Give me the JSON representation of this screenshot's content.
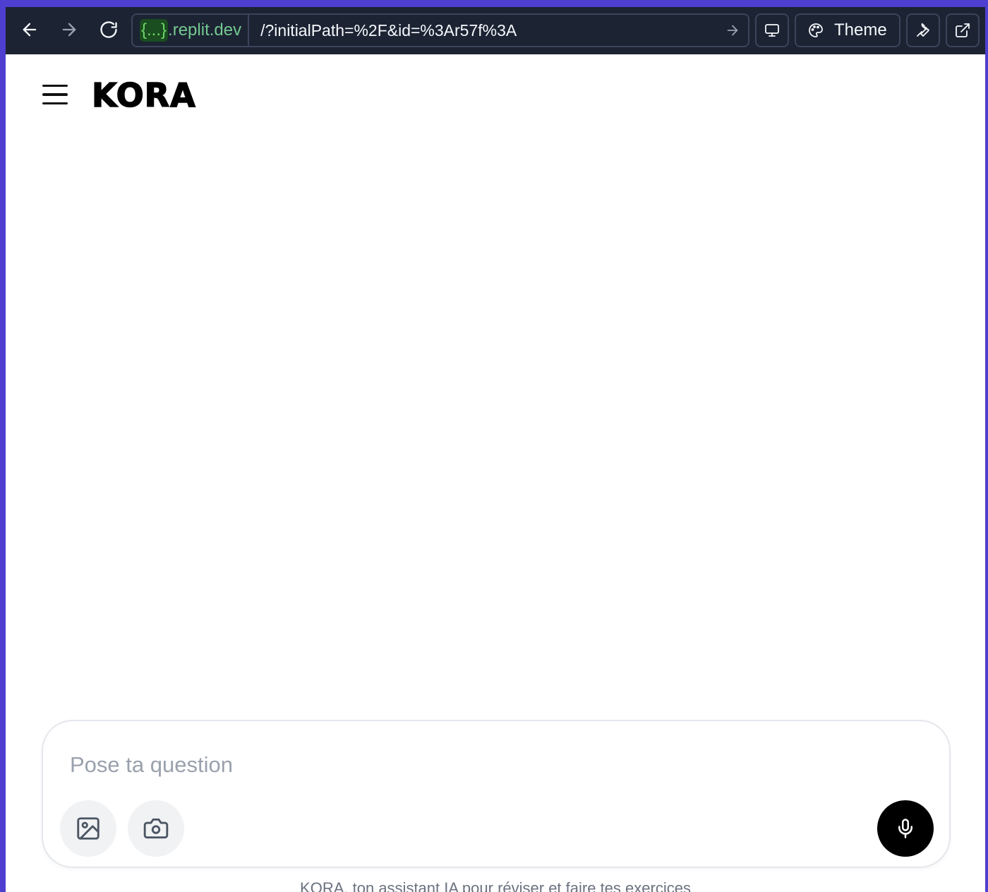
{
  "browser": {
    "domain_prefix": "{...}",
    "domain_suffix": ".replit.dev",
    "url_path": "/?initialPath=%2F&id=%3Ar57f%3A",
    "theme_label": "Theme"
  },
  "app": {
    "logo": "KORA",
    "composer": {
      "placeholder": "Pose ta question"
    },
    "footer_caption": "KORA, ton assistant IA pour réviser et faire tes exercices"
  },
  "colors": {
    "outer_accent": "#4f3fd1",
    "browser_bar": "#1c2333",
    "domain_green": "#73c991",
    "mic_button": "#000000"
  },
  "icons": {
    "back": "arrow-left-icon",
    "forward": "arrow-right-icon",
    "reload": "reload-icon",
    "go": "arrow-right-icon",
    "devices": "monitor-icon",
    "theme": "palette-icon",
    "tools": "wrench-icon",
    "new_tab": "external-link-icon",
    "menu": "hamburger-icon",
    "image": "image-icon",
    "camera": "camera-icon",
    "mic": "microphone-icon"
  }
}
